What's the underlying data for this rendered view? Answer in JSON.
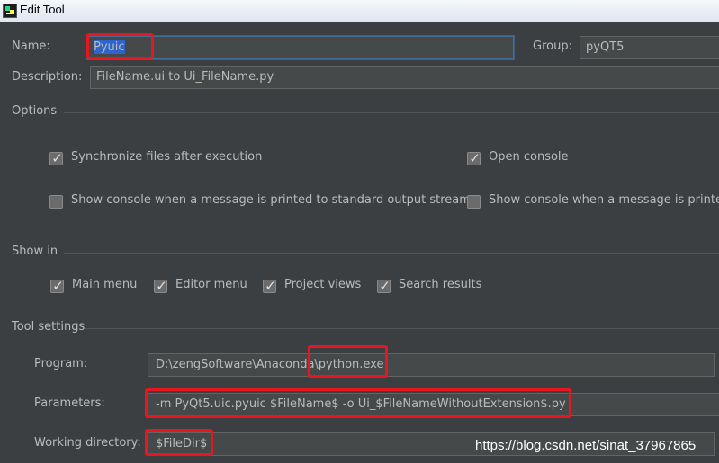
{
  "window": {
    "title": "Edit Tool"
  },
  "form": {
    "name_label": "Name:",
    "name_value": "Pyuic",
    "group_label": "Group:",
    "group_value": "pyQT5",
    "description_label": "Description:",
    "description_value": "FileName.ui to Ui_FileName.py"
  },
  "options": {
    "title": "Options",
    "sync_files": {
      "label": "Synchronize files after execution",
      "checked": true
    },
    "open_console": {
      "label": "Open console",
      "checked": true
    },
    "show_console_stdout": {
      "label": "Show console when a message is printed to standard output stream",
      "checked": false
    },
    "show_console_stderr": {
      "label": "Show console when a message is printed t",
      "checked": false
    }
  },
  "show_in": {
    "title": "Show in",
    "items": [
      {
        "label": "Main menu",
        "checked": true
      },
      {
        "label": "Editor menu",
        "checked": true
      },
      {
        "label": "Project views",
        "checked": true
      },
      {
        "label": "Search results",
        "checked": true
      }
    ]
  },
  "tool_settings": {
    "title": "Tool settings",
    "program_label": "Program:",
    "program_value": "D:\\zengSoftware\\Anaconda\\python.exe",
    "parameters_label": "Parameters:",
    "parameters_value": "-m PyQt5.uic.pyuic $FileName$  -o Ui_$FileNameWithoutExtension$.py",
    "working_dir_label": "Working directory:",
    "working_dir_value": "$FileDir$"
  },
  "watermark": "https://blog.csdn.net/sinat_37967865",
  "colors": {
    "background": "#3c3f41",
    "field": "#45494a",
    "selection": "#2f65ca",
    "annotation": "#e8161f"
  }
}
